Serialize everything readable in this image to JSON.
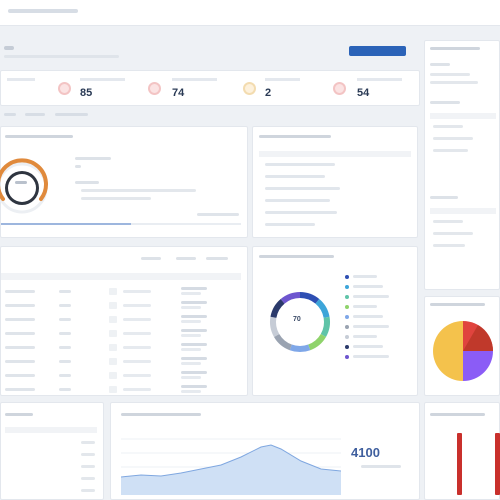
{
  "topbar": {
    "breadcrumb": "",
    "title": ""
  },
  "header": {
    "subtitle": "",
    "action_label": ""
  },
  "stats": [
    {
      "label": "",
      "value": ""
    },
    {
      "label": "",
      "value": "85"
    },
    {
      "label": "",
      "value": "74"
    },
    {
      "label": "",
      "value": "2"
    },
    {
      "label": "",
      "value": "54"
    }
  ],
  "tabs": [
    "",
    "",
    ""
  ],
  "gauge_panel": {
    "title": "",
    "value": ""
  },
  "list_panel": {
    "title": "",
    "items": [
      "",
      "",
      "",
      "",
      "",
      "",
      ""
    ]
  },
  "table_panel": {
    "headers": [
      "",
      "",
      "",
      ""
    ],
    "rows": [
      [
        "",
        "",
        "",
        ""
      ],
      [
        "",
        "",
        "",
        ""
      ],
      [
        "",
        "",
        "",
        ""
      ],
      [
        "",
        "",
        "",
        ""
      ],
      [
        "",
        "",
        "",
        ""
      ],
      [
        "",
        "",
        "",
        ""
      ],
      [
        "",
        "",
        "",
        ""
      ],
      [
        "",
        "",
        "",
        ""
      ]
    ]
  },
  "donut_panel": {
    "title": "",
    "center_value": "70",
    "legend": [
      "",
      "",
      "",
      "",
      "",
      "",
      "",
      "",
      ""
    ],
    "colors": [
      "#2e4fb3",
      "#3da5d9",
      "#5fc4a8",
      "#8fd36b",
      "#7fa7e8",
      "#9aa3b1",
      "#c6ccd6",
      "#2b3a6b",
      "#6e56cf"
    ]
  },
  "right_panel": {
    "title": "",
    "fields": [
      "",
      "",
      "",
      "",
      "",
      ""
    ]
  },
  "pie_panel": {
    "title": "",
    "colors": [
      "#e0443e",
      "#f4c24c",
      "#8b5cf6",
      "#c0392b"
    ]
  },
  "area_panel": {
    "title": "",
    "big_value": "4100",
    "sub": ""
  },
  "bars_panel": {
    "title": "",
    "color": "#c9302c"
  }
}
